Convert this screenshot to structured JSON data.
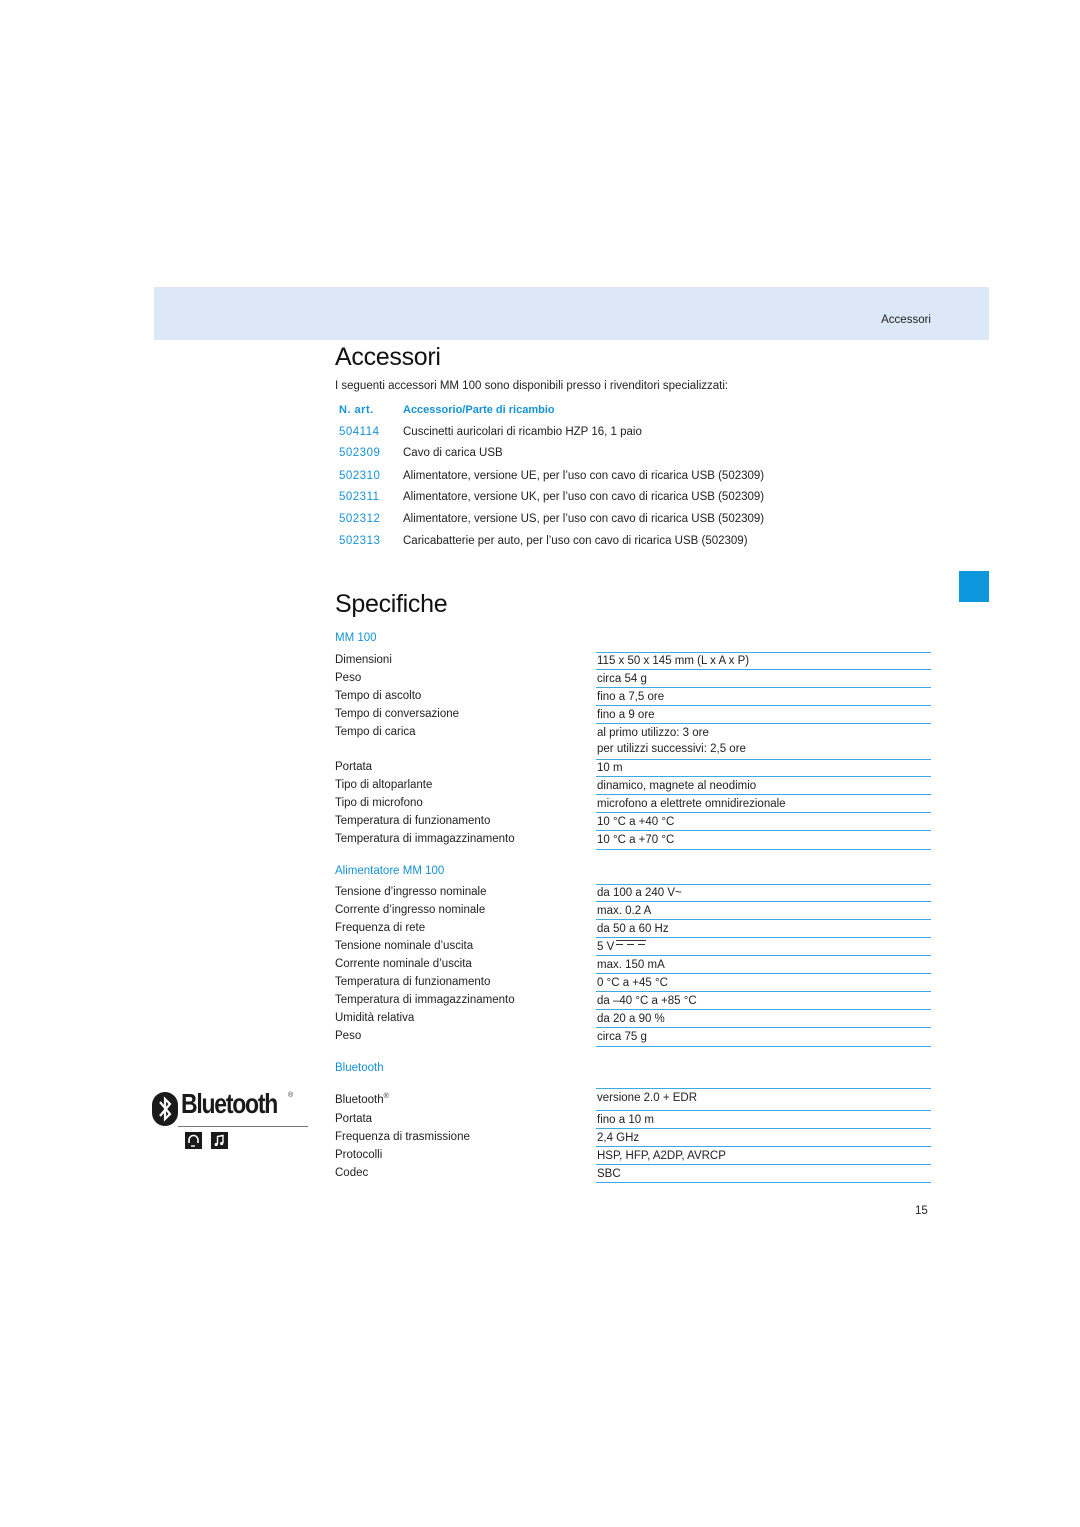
{
  "header": {
    "section_label": "Accessori"
  },
  "accessories": {
    "title": "Accessori",
    "intro": "I seguenti accessori MM 100 sono disponibili presso i rivenditori specializzati:",
    "columns": {
      "number": "N. art.",
      "description": "Accessorio/Parte di ricambio"
    },
    "rows": [
      {
        "number": "504114",
        "description": "Cuscinetti auricolari di ricambio HZP 16, 1 paio"
      },
      {
        "number": "502309",
        "description": "Cavo di carica USB"
      },
      {
        "number": "502310",
        "description": "Alimentatore, versione UE, per l’uso con cavo di ricarica USB (502309)"
      },
      {
        "number": "502311",
        "description": "Alimentatore, versione UK, per l’uso con cavo di ricarica USB (502309)"
      },
      {
        "number": "502312",
        "description": "Alimentatore, versione US, per l’uso con cavo di ricarica USB (502309)"
      },
      {
        "number": "502313",
        "description": "Caricabatterie per auto, per l’uso con cavo di ricarica USB (502309)"
      }
    ]
  },
  "specs": {
    "title": "Specifiche",
    "sections": [
      {
        "heading": "MM 100",
        "rows": [
          {
            "label": "Dimensioni",
            "value": "115 x 50 x 145 mm (L x A x P)"
          },
          {
            "label": "Peso",
            "value": "circa 54 g"
          },
          {
            "label": "Tempo di ascolto",
            "value": "fino a 7,5 ore"
          },
          {
            "label": "Tempo di conversazione",
            "value": "fino a 9 ore"
          },
          {
            "label": "Tempo di carica",
            "value": "al primo utilizzo: 3 ore",
            "value2": "per utilizzi successivi: 2,5 ore"
          },
          {
            "label": "Portata",
            "value": "10 m"
          },
          {
            "label": "Tipo di altoparlante",
            "value": "dinamico, magnete al neodimio"
          },
          {
            "label": "Tipo di microfono",
            "value": "microfono a elettrete omnidirezionale"
          },
          {
            "label": "Temperatura di funzionamento",
            "value": "10 °C a +40 °C"
          },
          {
            "label": "Temperatura di immagazzinamento",
            "value": "10 °C a +70 °C"
          }
        ]
      },
      {
        "heading": "Alimentatore MM 100",
        "rows": [
          {
            "label": "Tensione d’ingresso nominale",
            "value": "da 100 a 240 V~"
          },
          {
            "label": "Corrente d’ingresso nominale",
            "value": "max. 0.2 A"
          },
          {
            "label": "Frequenza di rete",
            "value": "da 50 a 60 Hz"
          },
          {
            "label": "Tensione nominale d’uscita",
            "value": "5 V"
          },
          {
            "label": "Corrente nominale d’uscita",
            "value": "max. 150 mA"
          },
          {
            "label": "Temperatura di funzionamento",
            "value": "0 °C a +45 °C"
          },
          {
            "label": "Temperatura di immagazzinamento",
            "value": "da –40 °C a +85 °C"
          },
          {
            "label": "Umidità relativa",
            "value": "da 20 a 90 %"
          },
          {
            "label": "Peso",
            "value": "circa 75 g"
          }
        ]
      },
      {
        "heading": "Bluetooth",
        "rows": [
          {
            "label": "Bluetooth",
            "label_sup": "®",
            "value": "versione 2.0 + EDR"
          },
          {
            "label": "Portata",
            "value": "fino a 10 m"
          },
          {
            "label": "Frequenza di trasmissione",
            "value": "2,4 GHz"
          },
          {
            "label": "Protocolli",
            "value": "HSP, HFP, A2DP, AVRCP"
          },
          {
            "label": "Codec",
            "value": "SBC"
          }
        ]
      }
    ]
  },
  "bluetooth_logo": {
    "wordmark": "Bluetooth",
    "registered": "®",
    "profile_icons": [
      "headset-profile-icon",
      "music-profile-icon"
    ]
  },
  "colors": {
    "accent": "#1592d6",
    "header_band": "#dce8f7",
    "rule": "#3fa8e0",
    "side_tab": "#0d96dc"
  },
  "page_number": "15"
}
